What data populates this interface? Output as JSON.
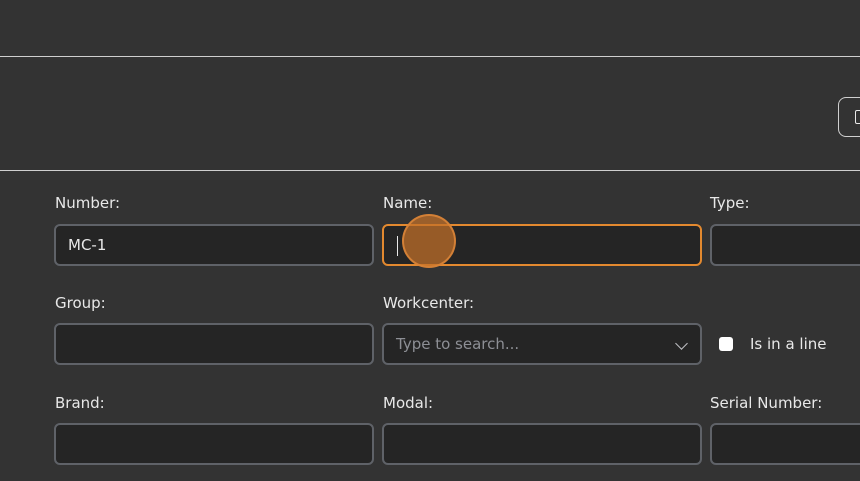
{
  "form": {
    "number": {
      "label": "Number:",
      "value": "MC-1"
    },
    "name": {
      "label": "Name:",
      "value": ""
    },
    "type": {
      "label": "Type:",
      "value": ""
    },
    "group": {
      "label": "Group:",
      "value": ""
    },
    "workcenter": {
      "label": "Workcenter:",
      "placeholder": "Type to search..."
    },
    "is_in_a_line": {
      "label": "Is in a line",
      "checked": false
    },
    "brand": {
      "label": "Brand:",
      "value": ""
    },
    "modal": {
      "label": "Modal:",
      "value": ""
    },
    "serial_number": {
      "label": "Serial Number:",
      "value": ""
    }
  },
  "colors": {
    "background": "#333333",
    "input_background": "#252525",
    "input_border": "#5f6268",
    "focus_border": "#e3892f",
    "text": "#e8e8e8",
    "placeholder": "#8d8f95"
  },
  "icons": {
    "edge_button": "document-icon",
    "workcenter_dropdown": "chevron-down-icon"
  }
}
